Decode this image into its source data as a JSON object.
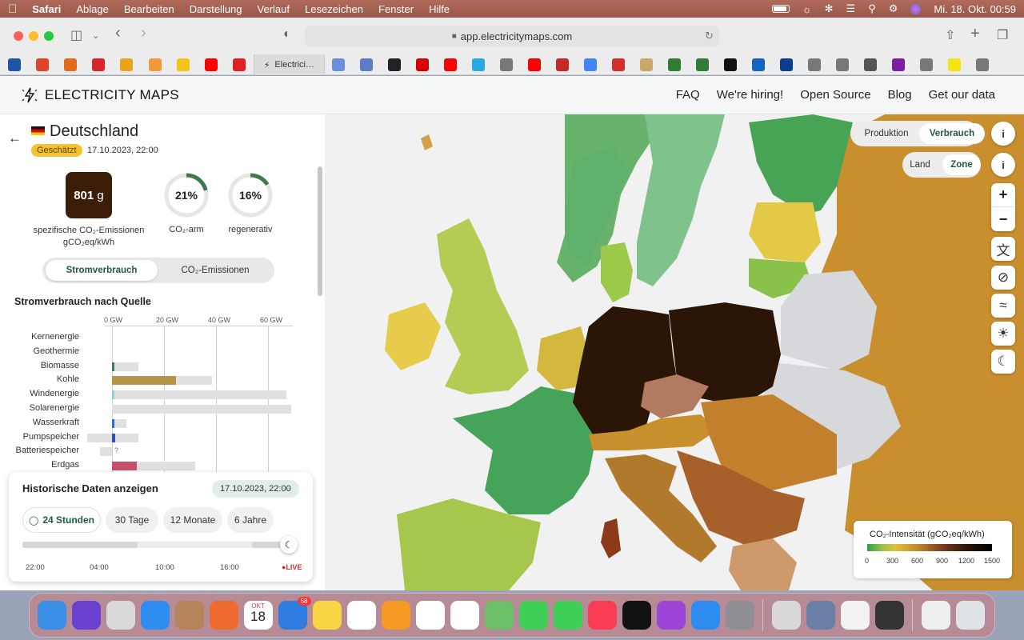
{
  "menubar": {
    "app": "Safari",
    "items": [
      "Ablage",
      "Bearbeiten",
      "Darstellung",
      "Verlauf",
      "Lesezeichen",
      "Fenster",
      "Hilfe"
    ],
    "clock": "Mi. 18. Okt.  00:59"
  },
  "browser": {
    "url": "app.electricitymaps.com",
    "active_tab": "Electrici…"
  },
  "favicons": [
    "#1f56a3",
    "#e0442b",
    "#e46a1d",
    "#d62828",
    "#e8a41b",
    "#f19a3a",
    "#f3c318",
    "#ff0000",
    "#e02020"
  ],
  "favicons2": [
    "#6b8fd6",
    "#5b7cc7",
    "#222222",
    "#d50000",
    "#ff0000",
    "#27a9e1",
    "#777777",
    "#ff0000",
    "#c62828",
    "#4285f4",
    "#d32f2f",
    "#c9a86a",
    "#2e7d32",
    "#2e7d32",
    "#111111",
    "#1565c0",
    "#0b3d91",
    "#777777",
    "#777777",
    "#555555",
    "#7b1fa2",
    "#777777",
    "#f1e410",
    "#777777"
  ],
  "site": {
    "brand": "ELECTRICITY MAPS",
    "nav": [
      "FAQ",
      "We're hiring!",
      "Open Source",
      "Blog",
      "Get our data"
    ]
  },
  "zone": {
    "name": "Deutschland",
    "badge": "Geschätzt",
    "datetime": "17.10.2023, 22:00",
    "intensity_value": "801",
    "intensity_unit": "g",
    "intensity_label1": "spezifische CO₂-Emissionen",
    "intensity_label2": "gCO₂eq/kWh",
    "low_carbon_pct": 21,
    "low_carbon_text": "21%",
    "low_carbon_label": "CO₂-arm",
    "renewable_pct": 16,
    "renewable_text": "16%",
    "renewable_label": "regenerativ"
  },
  "toggle": {
    "left": "Stromverbrauch",
    "right": "CO₂-Emissionen"
  },
  "breakdown": {
    "title": "Stromverbrauch nach Quelle",
    "ticks": [
      "0 GW",
      "20 GW",
      "40 GW",
      "60 GW"
    ],
    "rows": [
      {
        "label": "Kernenergie",
        "value": 0,
        "capacity": 0,
        "color": "#888888"
      },
      {
        "label": "Geothermie",
        "value": 0,
        "capacity": 0,
        "color": "#888888"
      },
      {
        "label": "Biomasse",
        "value": 1,
        "capacity": 10,
        "color": "#3d7a6b"
      },
      {
        "label": "Kohle",
        "value": 24.5,
        "capacity": 38.5,
        "color": "#b5934a"
      },
      {
        "label": "Windenergie",
        "value": 1,
        "capacity": 67,
        "color": "#8fd6c8"
      },
      {
        "label": "Solarenergie",
        "value": 0,
        "capacity": 69,
        "color": "#f5d33b"
      },
      {
        "label": "Wasserkraft",
        "value": 0.8,
        "capacity": 5.5,
        "color": "#2f6fd1"
      },
      {
        "label": "Pumpspeicher",
        "value": 1.2,
        "capacity": 10,
        "negative": 9.5,
        "color": "#2f52b8"
      },
      {
        "label": "Batteriespeicher",
        "value": 0,
        "capacity": 0,
        "negative": 4.5,
        "unknown": "?",
        "color": "#888888"
      },
      {
        "label": "Erdgas",
        "value": 9.5,
        "capacity": 32,
        "color": "#c9506a"
      }
    ]
  },
  "history": {
    "title": "Historische Daten anzeigen",
    "date": "17.10.2023, 22:00",
    "ranges": [
      "24 Stunden",
      "30 Tage",
      "12 Monate",
      "6 Jahre"
    ],
    "ticks": [
      "22:00",
      "04:00",
      "10:00",
      "16:00"
    ],
    "live": "LIVE"
  },
  "map_controls": {
    "mode_left": "Produktion",
    "mode_right": "Verbrauch",
    "view_left": "Land",
    "view_right": "Zone",
    "info": "i",
    "zoom_in": "+",
    "zoom_out": "−"
  },
  "legend": {
    "title": "CO₂-Intensität (gCO₂eq/kWh)",
    "ticks": [
      "0",
      "300",
      "600",
      "900",
      "1200",
      "1500"
    ]
  },
  "dock": {
    "calendar_month": "OKT",
    "calendar_day": "18",
    "mail_badge": "58",
    "apps": [
      "finder",
      "siri",
      "launchpad",
      "safari",
      "contacts",
      "firefox",
      "calendar",
      "mail",
      "notes",
      "freeform",
      "pages",
      "reminders",
      "photos",
      "maps",
      "messages",
      "facetime",
      "music",
      "tv",
      "podcasts",
      "appstore",
      "settings",
      "script",
      "preview",
      "textedit",
      "keychain",
      "mail-doc",
      "trash"
    ]
  }
}
